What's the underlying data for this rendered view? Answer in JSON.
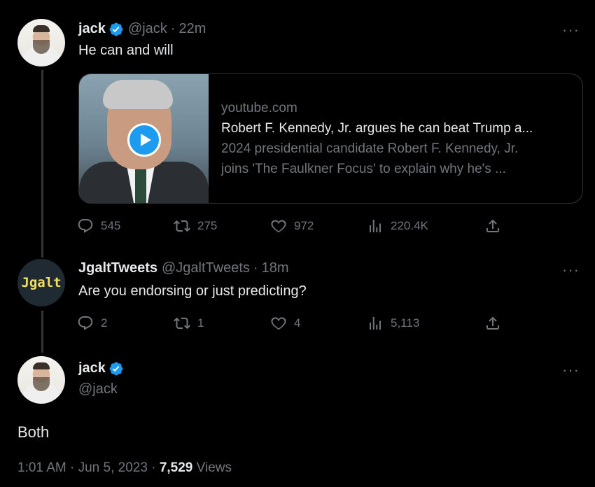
{
  "tweet1": {
    "name": "jack",
    "handle": "@jack",
    "time": "22m",
    "text": "He can and will",
    "more": "···",
    "card": {
      "domain": "youtube.com",
      "title": "Robert F. Kennedy, Jr. argues he can beat Trump a...",
      "desc_line1": "2024 presidential candidate Robert F. Kennedy, Jr.",
      "desc_line2": "joins 'The Faulkner Focus' to explain why he's ..."
    },
    "replies": "545",
    "retweets": "275",
    "likes": "972",
    "views": "220.4K"
  },
  "tweet2": {
    "name": "JgaltTweets",
    "handle": "@JgaltTweets",
    "time": "18m",
    "avatar_text": "Jgalt",
    "text": "Are you endorsing or just predicting?",
    "more": "···",
    "replies": "2",
    "retweets": "1",
    "likes": "4",
    "views": "5,113"
  },
  "main": {
    "name": "jack",
    "handle": "@jack",
    "text": "Both",
    "more": "···",
    "time": "1:01 AM",
    "date": "Jun 5, 2023",
    "views_count": "7,529",
    "views_label": "Views"
  },
  "colors": {
    "background": "#000000",
    "text": "#e7e9ea",
    "muted": "#71767b",
    "accent": "#1d9bf0"
  },
  "icons": [
    "verified-badge-icon",
    "more-icon",
    "play-icon",
    "reply-icon",
    "retweet-icon",
    "like-icon",
    "views-icon",
    "share-icon"
  ]
}
